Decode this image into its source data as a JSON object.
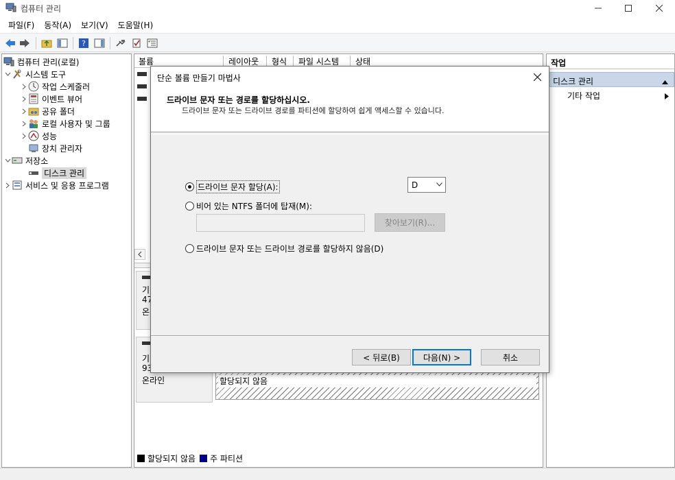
{
  "window": {
    "title": "컴퓨터 관리"
  },
  "menu": [
    "파일(F)",
    "동작(A)",
    "보기(V)",
    "도움말(H)"
  ],
  "tree": {
    "root": "컴퓨터 관리(로컬)",
    "system_tools": "시스템 도구",
    "task_scheduler": "작업 스케줄러",
    "event_viewer": "이벤트 뷰어",
    "shared_folders": "공유 폴더",
    "local_users": "로컬 사용자 및 그룹",
    "performance": "성능",
    "device_manager": "장치 관리자",
    "storage": "저장소",
    "disk_management": "디스크 관리",
    "services": "서비스 및 응용 프로그램"
  },
  "volume_table": {
    "columns": [
      "볼륨",
      "레이아웃",
      "형식",
      "파일 시스템",
      "상태"
    ]
  },
  "disks": [
    {
      "line1": "기",
      "line2": "47",
      "line3": "온"
    },
    {
      "line1": "기",
      "line2": "93",
      "line3": "온라인",
      "partition_label": "할당되지 않음"
    }
  ],
  "legend": {
    "unallocated": "할당되지 않음",
    "primary": "주 파티션"
  },
  "actions": {
    "header": "작업",
    "section": "디스크 관리",
    "more": "기타 작업"
  },
  "dialog": {
    "title": "단순 볼륨 만들기 마법사",
    "heading": "드라이브 문자 또는 경로를 할당하십시오.",
    "subheading": "드라이브 문자 또는 드라이브 경로를 파티션에 할당하여 쉽게 액세스할 수 있습니다.",
    "option_assign": "드라이브 문자 할당(A):",
    "drive_letter": "D",
    "option_mount": "비어 있는 NTFS 폴더에 탑재(M):",
    "browse": "찾아보기(R)...",
    "option_none": "드라이브 문자 또는 드라이브 경로를 할당하지 않음(D)",
    "back": "< 뒤로(B)",
    "next": "다음(N) >",
    "cancel": "취소"
  },
  "colors": {
    "unallocated": "#000000",
    "primary": "#000080",
    "selection": "#c9d7e8"
  }
}
